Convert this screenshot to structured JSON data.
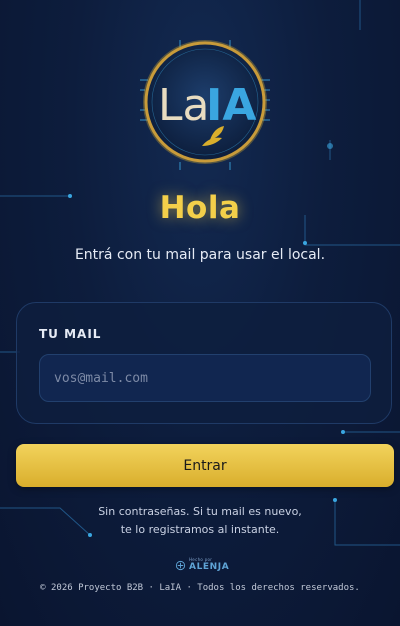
{
  "logo": {
    "text_left": "La",
    "text_right": "IA"
  },
  "greeting": "Hola",
  "subtitle": "Entrá con tu mail para usar el local.",
  "form": {
    "email_label": "TU MAIL",
    "email_value": "",
    "email_placeholder": "vos@mail.com",
    "submit_label": "Entrar"
  },
  "note": {
    "line1": "Sin contraseñas. Si tu mail es nuevo,",
    "line2": "te lo registramos al instante."
  },
  "brand": {
    "tagline": "Hecho por",
    "name": "ALENJA"
  },
  "footer": "© 2026 Proyecto B2B · LaIA · Todos los derechos reservados.",
  "colors": {
    "background": "#0d1d3d",
    "accent_gold": "#f3cf4a",
    "circuit": "#3aa6e0",
    "card_border": "#1f3a66"
  },
  "icons": {
    "logo_leaf": "laurel-leaf-icon",
    "brand_mark": "alenja-mark-icon"
  }
}
